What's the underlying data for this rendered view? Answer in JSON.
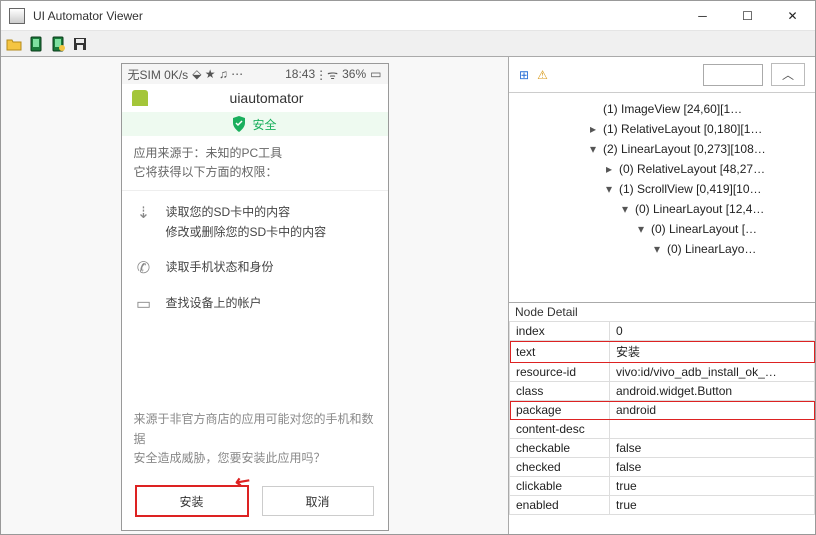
{
  "window": {
    "title": "UI Automator Viewer"
  },
  "phone": {
    "status": {
      "left": "无SIM 0K/s",
      "time": "18:43",
      "battery": "36%"
    },
    "appname": "uiautomator",
    "safe": "安全",
    "info_line1": "应用来源于：未知的PC工具",
    "info_line2": "它将获得以下方面的权限：",
    "perms": [
      {
        "icon": "sd",
        "l1": "读取您的SD卡中的内容",
        "l2": "修改或删除您的SD卡中的内容"
      },
      {
        "icon": "phone",
        "l1": "读取手机状态和身份",
        "l2": ""
      },
      {
        "icon": "account",
        "l1": "查找设备上的帐户",
        "l2": ""
      }
    ],
    "warn_l1": "来源于非官方商店的应用可能对您的手机和数据",
    "warn_l2": "安全造成威胁，您要安装此应用吗？",
    "btn_install": "安装",
    "btn_cancel": "取消"
  },
  "tree": {
    "n0": "(1) ImageView [24,60][1…",
    "n1": "(1) RelativeLayout [0,180][1…",
    "n2": "(2) LinearLayout [0,273][108…",
    "n3": "(0) RelativeLayout [48,27…",
    "n4": "(1) ScrollView [0,419][10…",
    "n5": "(0) LinearLayout [12,4…",
    "n6": "(0) LinearLayout […",
    "n7": "(0) LinearLayo…"
  },
  "detail": {
    "title": "Node Detail",
    "rows": [
      {
        "k": "index",
        "v": "0"
      },
      {
        "k": "text",
        "v": "安装"
      },
      {
        "k": "resource-id",
        "v": "vivo:id/vivo_adb_install_ok_…"
      },
      {
        "k": "class",
        "v": "android.widget.Button"
      },
      {
        "k": "package",
        "v": "android"
      },
      {
        "k": "content-desc",
        "v": ""
      },
      {
        "k": "checkable",
        "v": "false"
      },
      {
        "k": "checked",
        "v": "false"
      },
      {
        "k": "clickable",
        "v": "true"
      },
      {
        "k": "enabled",
        "v": "true"
      }
    ],
    "highlight_rows": [
      1,
      4
    ]
  }
}
